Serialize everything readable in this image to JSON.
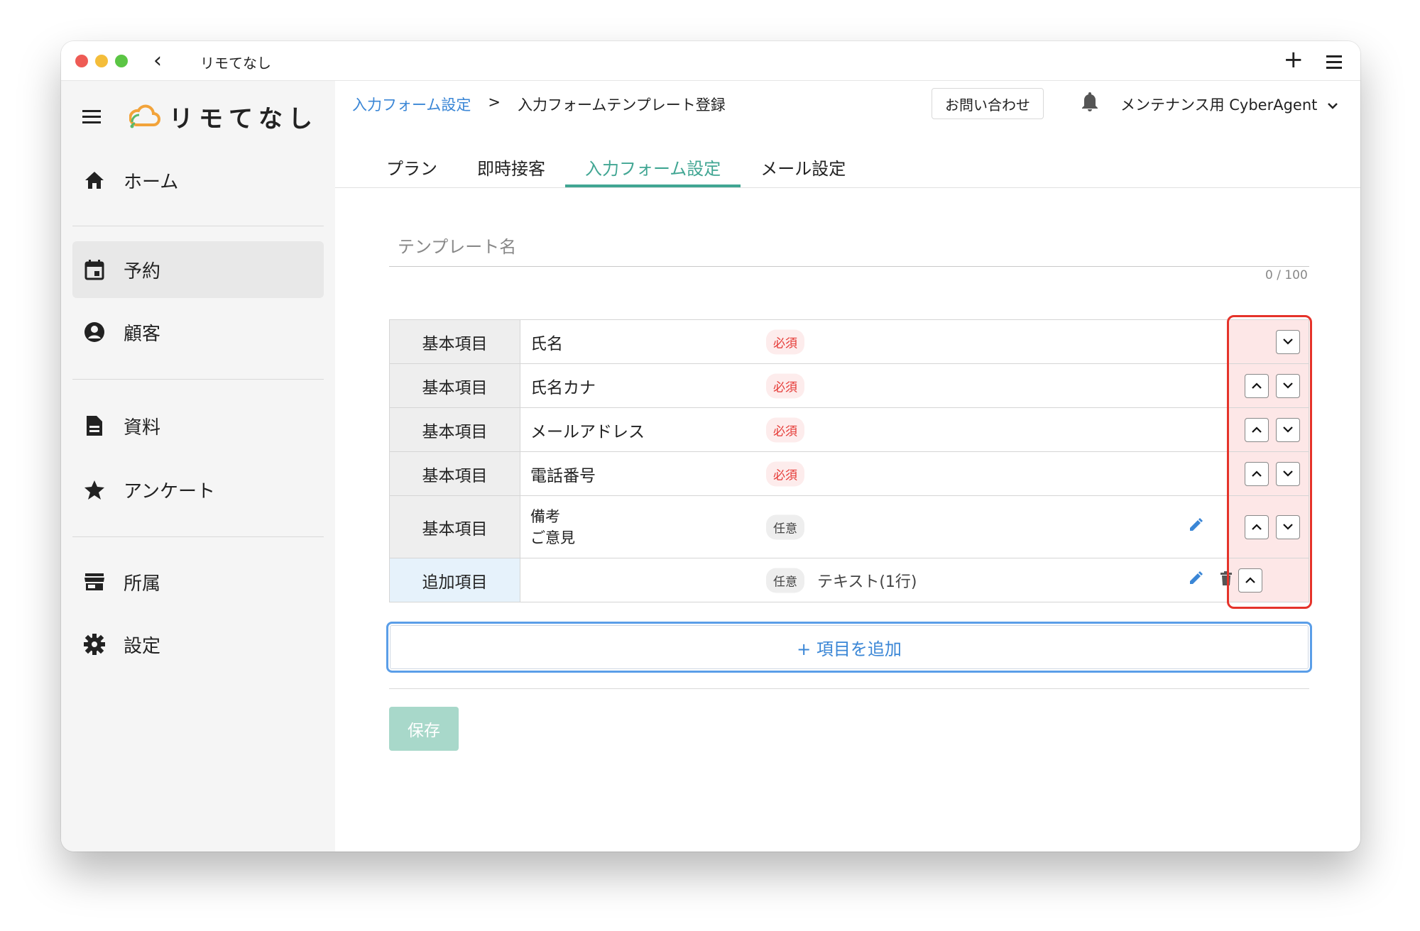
{
  "window": {
    "title": "リモてなし"
  },
  "logo": {
    "text": "リモてなし",
    "icon": "cloud-signal-icon"
  },
  "sidebar": {
    "items": [
      {
        "label": "ホーム",
        "icon": "home-icon"
      },
      {
        "label": "予約",
        "icon": "calendar-icon",
        "active": true
      },
      {
        "label": "顧客",
        "icon": "account-icon"
      },
      {
        "label": "資料",
        "icon": "document-icon"
      },
      {
        "label": "アンケート",
        "icon": "star-icon"
      },
      {
        "label": "所属",
        "icon": "store-icon"
      },
      {
        "label": "設定",
        "icon": "gear-icon"
      }
    ]
  },
  "breadcrumb": {
    "link": "入力フォーム設定",
    "separator": ">",
    "current": "入力フォームテンプレート登録"
  },
  "header": {
    "contact": "お問い合わせ",
    "user": "メンテナンス用 CyberAgent"
  },
  "tabs": [
    "プラン",
    "即時接客",
    "入力フォーム設定",
    "メール設定"
  ],
  "active_tab": "入力フォーム設定",
  "template": {
    "placeholder": "テンプレート名",
    "counter": "0 / 100"
  },
  "rows": [
    {
      "type": "基本項目",
      "name": "氏名",
      "badge": "必須",
      "controls": [
        "down"
      ]
    },
    {
      "type": "基本項目",
      "name": "氏名カナ",
      "badge": "必須",
      "controls": [
        "up",
        "down"
      ]
    },
    {
      "type": "基本項目",
      "name": "メールアドレス",
      "badge": "必須",
      "controls": [
        "up",
        "down"
      ]
    },
    {
      "type": "基本項目",
      "name": "電話番号",
      "badge": "必須",
      "controls": [
        "up",
        "down"
      ]
    },
    {
      "type": "基本項目",
      "name_lines": [
        "備考",
        "ご意見"
      ],
      "badge": "任意",
      "editable": true,
      "controls": [
        "up",
        "down"
      ]
    },
    {
      "type": "追加項目",
      "name": "",
      "badge": "任意",
      "field_type": "テキスト(1行)",
      "editable": true,
      "deletable": true,
      "controls": [
        "up"
      ]
    }
  ],
  "add_button": "+ 項目を追加",
  "save_button": "保存",
  "colors": {
    "accent": "#41a693",
    "link": "#3a86d6",
    "required": "#e53935",
    "highlight": "#e5332a"
  }
}
